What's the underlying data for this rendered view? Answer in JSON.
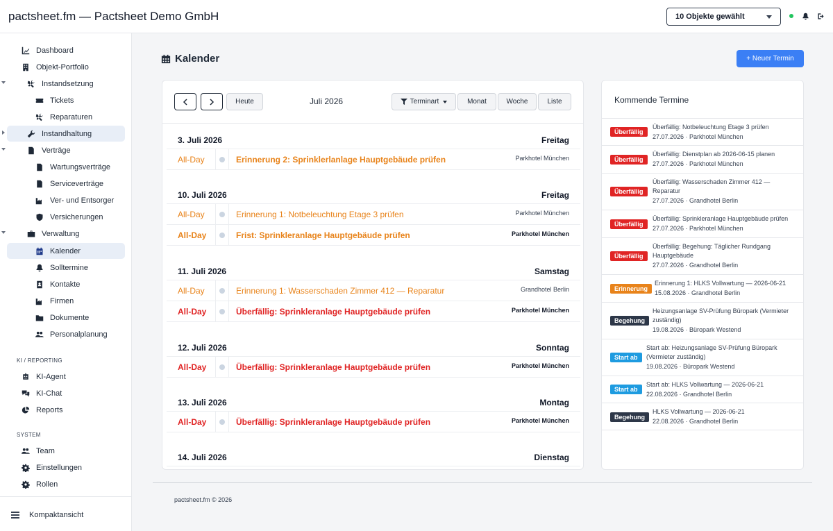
{
  "header": {
    "brand": "pactsheet.fm — Pactsheet Demo GmbH",
    "object_select": "10 Objekte gewählt"
  },
  "sidebar": {
    "items": [
      {
        "label": "Dashboard",
        "icon": "chart-line-icon"
      },
      {
        "label": "Objekt-Portfolio",
        "icon": "building-icon"
      },
      {
        "label": "Instandsetzung",
        "icon": "tools-icon"
      },
      {
        "label": "Tickets",
        "icon": "ticket-icon"
      },
      {
        "label": "Reparaturen",
        "icon": "tools-icon"
      },
      {
        "label": "Instandhaltung",
        "icon": "wrench-icon"
      },
      {
        "label": "Verträge",
        "icon": "file-icon"
      },
      {
        "label": "Wartungsverträge",
        "icon": "file-icon"
      },
      {
        "label": "Serviceverträge",
        "icon": "file-icon"
      },
      {
        "label": "Ver- und Entsorger",
        "icon": "industry-icon"
      },
      {
        "label": "Versicherungen",
        "icon": "shield-icon"
      },
      {
        "label": "Verwaltung",
        "icon": "briefcase-icon"
      },
      {
        "label": "Kalender",
        "icon": "calendar-icon"
      },
      {
        "label": "Solltermine",
        "icon": "bell-icon"
      },
      {
        "label": "Kontakte",
        "icon": "address-book-icon"
      },
      {
        "label": "Firmen",
        "icon": "industry-icon"
      },
      {
        "label": "Dokumente",
        "icon": "folder-icon"
      },
      {
        "label": "Personalplanung",
        "icon": "users-icon"
      },
      {
        "label": "KI-Agent",
        "icon": "robot-icon"
      },
      {
        "label": "KI-Chat",
        "icon": "comments-icon"
      },
      {
        "label": "Reports",
        "icon": "pie-chart-icon"
      },
      {
        "label": "Team",
        "icon": "users-icon"
      },
      {
        "label": "Einstellungen",
        "icon": "gear-icon"
      },
      {
        "label": "Rollen",
        "icon": "gear-icon"
      }
    ],
    "section_ki": "KI / REPORTING",
    "section_system": "SYSTEM",
    "compact": "Kompaktansicht"
  },
  "main": {
    "title": "Kalender",
    "new_button": "+ Neuer Termin"
  },
  "calendar": {
    "today": "Heute",
    "month": "Juli 2026",
    "filter": "Terminart",
    "views": [
      "Monat",
      "Woche",
      "Liste"
    ],
    "days": [
      {
        "date": "3. Juli 2026",
        "weekday": "Freitag",
        "events": [
          {
            "time": "All-Day",
            "title": "Erinnerung 2: Sprinklerlanlage Hauptgebäude prüfen",
            "location": "Parkhotel München",
            "kind": "reminder-bold"
          }
        ]
      },
      {
        "date": "10. Juli 2026",
        "weekday": "Freitag",
        "events": [
          {
            "time": "All-Day",
            "title": "Erinnerung 1: Notbeleuchtung Etage 3 prüfen",
            "location": "Parkhotel München",
            "kind": "reminder"
          },
          {
            "time": "All-Day",
            "title": "Frist: Sprinkleranlage Hauptgebäude prüfen",
            "location": "Parkhotel München",
            "kind": "deadline"
          }
        ]
      },
      {
        "date": "11. Juli 2026",
        "weekday": "Samstag",
        "events": [
          {
            "time": "All-Day",
            "title": "Erinnerung 1: Wasserschaden Zimmer 412 — Reparatur",
            "location": "Grandhotel Berlin",
            "kind": "reminder"
          },
          {
            "time": "All-Day",
            "title": "Überfällig: Sprinkleranlage Hauptgebäude prüfen",
            "location": "Parkhotel München",
            "kind": "overdue"
          }
        ]
      },
      {
        "date": "12. Juli 2026",
        "weekday": "Sonntag",
        "events": [
          {
            "time": "All-Day",
            "title": "Überfällig: Sprinkleranlage Hauptgebäude prüfen",
            "location": "Parkhotel München",
            "kind": "overdue"
          }
        ]
      },
      {
        "date": "13. Juli 2026",
        "weekday": "Montag",
        "events": [
          {
            "time": "All-Day",
            "title": "Überfällig: Sprinkleranlage Hauptgebäude prüfen",
            "location": "Parkhotel München",
            "kind": "overdue"
          }
        ]
      },
      {
        "date": "14. Juli 2026",
        "weekday": "Dienstag",
        "events": []
      }
    ]
  },
  "upcoming": {
    "title": "Kommende Termine",
    "items": [
      {
        "badge": "Überfällig",
        "type": "red",
        "lines": [
          "Überfällig: Notbeleuchtung Etage 3 prüfen",
          "27.07.2026 · Parkhotel München"
        ]
      },
      {
        "badge": "Überfällig",
        "type": "red",
        "lines": [
          "Überfällig: Dienstplan ab 2026-06-15 planen",
          "27.07.2026 · Parkhotel München"
        ]
      },
      {
        "badge": "Überfällig",
        "type": "red",
        "lines": [
          "Überfällig: Wasserschaden Zimmer 412 —",
          "Reparatur",
          "27.07.2026 · Grandhotel Berlin"
        ]
      },
      {
        "badge": "Überfällig",
        "type": "red",
        "lines": [
          "Überfällig: Sprinkleranlage Hauptgebäude prüfen",
          "27.07.2026 · Parkhotel München"
        ]
      },
      {
        "badge": "Überfällig",
        "type": "red",
        "lines": [
          "Überfällig: Begehung: Täglicher Rundgang",
          "Hauptgebäude",
          "27.07.2026 · Grandhotel Berlin"
        ]
      },
      {
        "badge": "Erinnerung",
        "type": "orange",
        "lines": [
          "Erinnerung 1: HLKS Vollwartung — 2026-06-21",
          "15.08.2026 · Grandhotel Berlin"
        ]
      },
      {
        "badge": "Begehung",
        "type": "dark",
        "lines": [
          "Heizungsanlage SV-Prüfung Büropark (Vermieter",
          "zuständig)",
          "19.08.2026 · Büropark Westend"
        ]
      },
      {
        "badge": "Start ab",
        "type": "blue",
        "lines": [
          "Start ab: Heizungsanlage SV-Prüfung Büropark",
          "(Vermieter zuständig)",
          "19.08.2026 · Büropark Westend"
        ]
      },
      {
        "badge": "Start ab",
        "type": "blue",
        "lines": [
          "Start ab: HLKS Vollwartung — 2026-06-21",
          "22.08.2026 · Grandhotel Berlin"
        ]
      },
      {
        "badge": "Begehung",
        "type": "dark",
        "lines": [
          "HLKS Vollwartung — 2026-06-21",
          "22.08.2026 · Grandhotel Berlin"
        ]
      }
    ]
  },
  "footer": "pactsheet.fm © 2026",
  "colors": {
    "primary": "#3b7ff5",
    "overdue": "#e02424",
    "reminder": "#e8831a",
    "dark_badge": "#2d3748",
    "start_badge": "#1e9be0",
    "online": "#22c55e"
  }
}
